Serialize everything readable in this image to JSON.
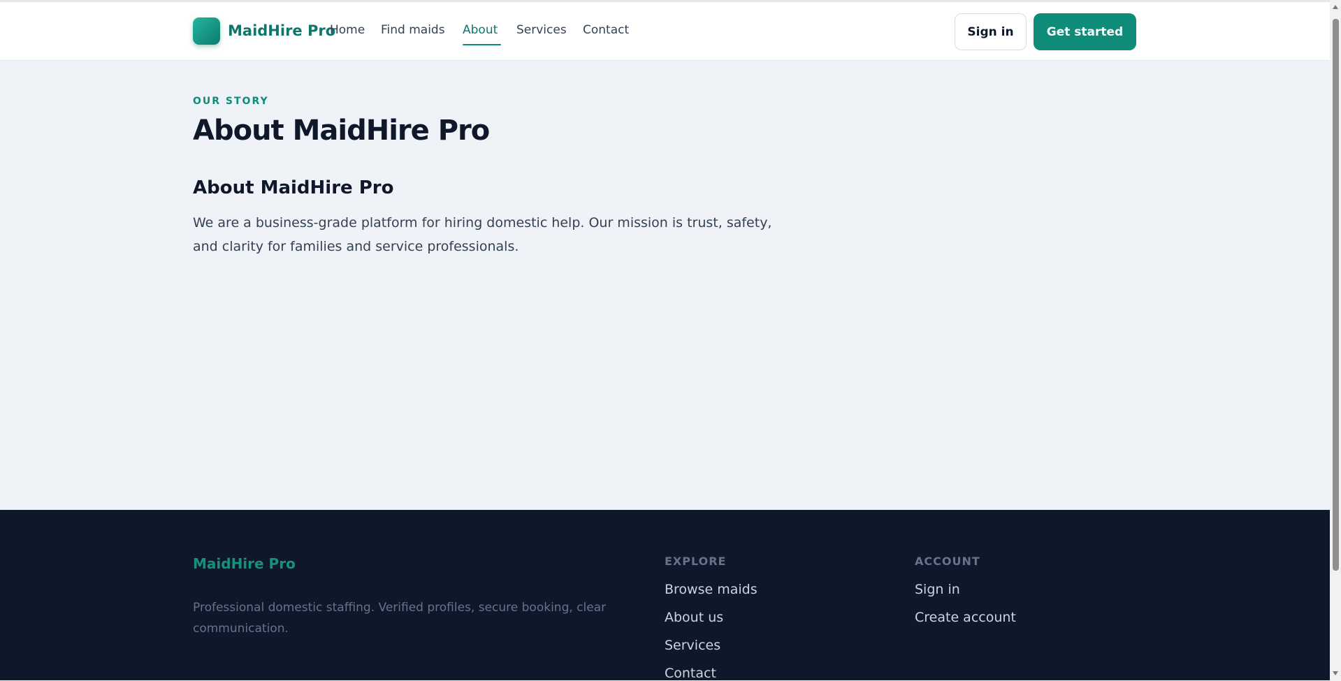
{
  "header": {
    "brand": "MaidHire Pro",
    "nav": [
      {
        "label": "Home"
      },
      {
        "label": "Find maids"
      },
      {
        "label": "About",
        "active": true
      },
      {
        "label": "Services"
      },
      {
        "label": "Contact"
      }
    ],
    "sign_in_label": "Sign in",
    "get_started_label": "Get started"
  },
  "main": {
    "eyebrow": "OUR STORY",
    "title": "About MaidHire Pro",
    "section_title": "About MaidHire Pro",
    "intro": "We are a business-grade platform for hiring domestic help. Our mission is trust, safety, and clarity for families and service professionals."
  },
  "footer": {
    "brand": "MaidHire Pro",
    "tagline": "Professional domestic staffing. Verified profiles, secure booking, clear communication.",
    "explore": {
      "heading": "EXPLORE",
      "links": [
        "Browse maids",
        "About us",
        "Services",
        "Contact"
      ]
    },
    "account": {
      "heading": "ACCOUNT",
      "links": [
        "Sign in",
        "Create account"
      ]
    }
  },
  "colors": {
    "brand": "#0f766e",
    "accent": "#0f8b7a",
    "page_bg": "#eff3f8",
    "footer_bg": "#0f172a"
  },
  "icons": {
    "logo": "logo-icon"
  }
}
